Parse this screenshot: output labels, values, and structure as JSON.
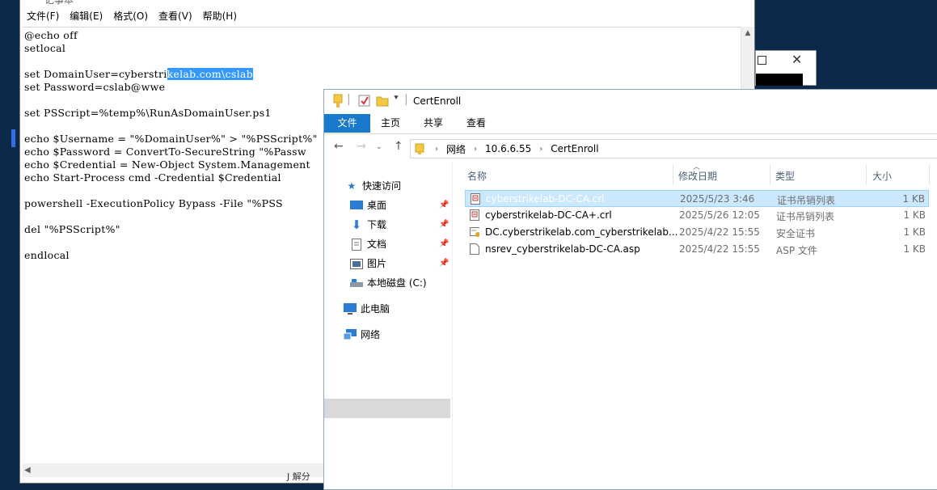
{
  "notepad": {
    "title": "记事本",
    "menu": [
      "文件(F)",
      "编辑(E)",
      "格式(O)",
      "查看(V)",
      "帮助(H)"
    ],
    "lines": [
      "@echo off",
      "setlocal",
      "",
      "set DomainUser=cyberstrikelab.com\\cslab",
      "set Password=cslab@wwe",
      "",
      "set PSScript=%temp%\\RunAsDomainUser.ps1",
      "",
      "echo $Username = \"%DomainUser%\" > \"%PSScript%\"",
      "echo $Password = ConvertTo-SecureString \"%Passw",
      "echo $Credential = New-Object System.Management",
      "echo Start-Process cmd -Credential $Credential",
      "",
      "powershell -ExecutionPolicy Bypass -File \"%PSS",
      "",
      "del \"%PSScript%\"",
      "",
      "endlocal"
    ],
    "selection": {
      "line_index": 3,
      "selected_text": "kelab.com\\cslab",
      "prefix": "set DomainUser=cyberstri"
    },
    "status_fragment": "J 解分"
  },
  "explorer": {
    "title": "CertEnroll",
    "ribbon_tabs": [
      "文件",
      "主页",
      "共享",
      "查看"
    ],
    "breadcrumb": [
      "网络",
      "10.6.6.55",
      "CertEnroll"
    ],
    "nav_items": [
      {
        "label": "快速访问",
        "icon": "star-icon",
        "pinned": false
      },
      {
        "label": "桌面",
        "icon": "desktop-icon",
        "pinned": true
      },
      {
        "label": "下载",
        "icon": "download-icon",
        "pinned": true
      },
      {
        "label": "文档",
        "icon": "document-icon",
        "pinned": true
      },
      {
        "label": "图片",
        "icon": "picture-icon",
        "pinned": true
      },
      {
        "label": "本地磁盘 (C:)",
        "icon": "drive-icon",
        "pinned": false
      },
      {
        "label": "此电脑",
        "icon": "computer-icon",
        "pinned": false
      },
      {
        "label": "网络",
        "icon": "network-icon",
        "pinned": false
      }
    ],
    "columns": [
      "名称",
      "修改日期",
      "类型",
      "大小"
    ],
    "files": [
      {
        "name": "cyberstrikelab-DC-CA.crl",
        "date": "2025/5/23 3:46",
        "type": "证书吊销列表",
        "size": "1 KB",
        "icon": "crl-file-icon"
      },
      {
        "name": "cyberstrikelab-DC-CA+.crl",
        "date": "2025/5/26 12:05",
        "type": "证书吊销列表",
        "size": "1 KB",
        "icon": "crl-file-icon"
      },
      {
        "name": "DC.cyberstrikelab.com_cyberstrikelab...",
        "date": "2025/4/22 15:55",
        "type": "安全证书",
        "size": "1 KB",
        "icon": "certificate-file-icon"
      },
      {
        "name": "nsrev_cyberstrikelab-DC-CA.asp",
        "date": "2025/4/22 15:55",
        "type": "ASP 文件",
        "size": "1 KB",
        "icon": "blank-file-icon"
      }
    ],
    "colors": {
      "accent": "#1979ca",
      "selection": "#cce8ff",
      "folder": "#f5c842"
    }
  }
}
